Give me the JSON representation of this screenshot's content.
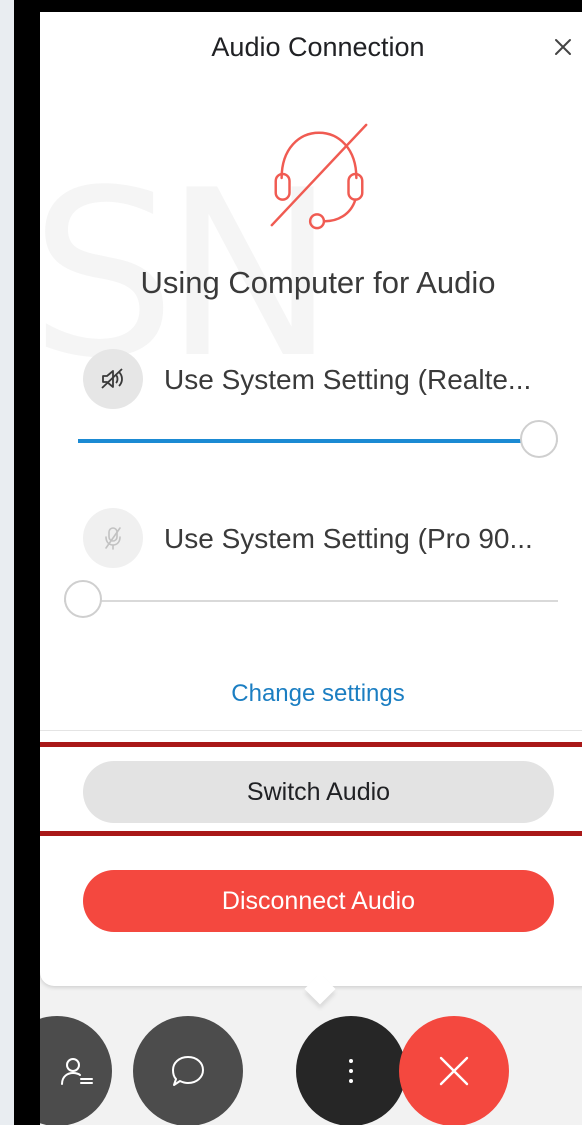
{
  "dialog": {
    "title": "Audio Connection",
    "close_icon": "close-icon",
    "status_icon": "headset-muted-icon",
    "status": "Using Computer for Audio"
  },
  "speaker": {
    "icon": "speaker-muted-icon",
    "label": "Use System Setting (Realte...",
    "volume": 1.0
  },
  "microphone": {
    "icon": "microphone-muted-icon",
    "label": "Use System Setting (Pro 90...",
    "volume": 0.0
  },
  "change_settings": "Change settings",
  "buttons": {
    "switch_audio": "Switch Audio",
    "disconnect_audio": "Disconnect Audio"
  },
  "toolbar": [
    {
      "icon": "participants-icon"
    },
    {
      "icon": "chat-icon"
    },
    {
      "icon": "more-options-icon"
    },
    {
      "icon": "leave-meeting-icon"
    }
  ],
  "colors": {
    "accent": "#1b8ad3",
    "link": "#1b7ec2",
    "danger": "#f4483f",
    "highlight": "#a91818",
    "icon_red": "#f05b52"
  }
}
